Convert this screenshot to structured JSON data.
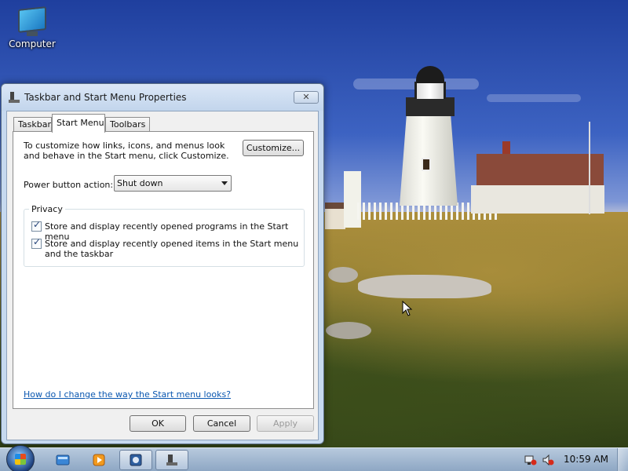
{
  "desktop": {
    "icons": [
      {
        "label": "Computer",
        "icon": "computer-icon"
      }
    ]
  },
  "dialog": {
    "title": "Taskbar and Start Menu Properties",
    "close_label": "✕",
    "tabs": [
      {
        "label": "Taskbar",
        "active": false
      },
      {
        "label": "Start Menu",
        "active": true
      },
      {
        "label": "Toolbars",
        "active": false
      }
    ],
    "intro_text": "To customize how links, icons, and menus look and behave in the Start menu, click Customize.",
    "customize_label": "Customize...",
    "power_label": "Power button action:",
    "power_value": "Shut down",
    "privacy_title": "Privacy",
    "privacy_options": [
      {
        "label": "Store and display recently opened programs in the Start menu",
        "checked": true
      },
      {
        "label": "Store and display recently opened items in the Start menu and the taskbar",
        "checked": true
      }
    ],
    "help_link": "How do I change the way the Start menu looks?",
    "ok_label": "OK",
    "cancel_label": "Cancel",
    "apply_label": "Apply",
    "apply_enabled": false
  },
  "taskbar": {
    "start_icon": "windows-orb-icon",
    "pinned": [
      "internet-explorer-icon",
      "media-player-icon"
    ],
    "windows": [
      "control-panel-app-icon",
      "taskbar-properties-app-icon"
    ],
    "tray_icons": [
      "network-icon",
      "volume-muted-icon"
    ],
    "clock": "10:59 AM"
  },
  "colors": {
    "link": "#0a57b0",
    "dialog_frame": "#c6d9ef",
    "taskbar": "#8ea7c4"
  }
}
